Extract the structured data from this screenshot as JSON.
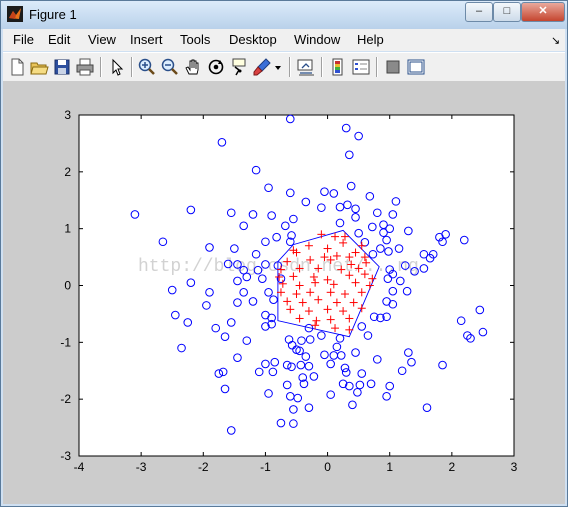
{
  "window": {
    "title": "Figure 1",
    "controls": [
      "minimize",
      "maximize",
      "close"
    ]
  },
  "menu": [
    "File",
    "Edit",
    "View",
    "Insert",
    "Tools",
    "Desktop",
    "Window",
    "Help"
  ],
  "menu_arrow": "↘",
  "toolbar": [
    "new-figure-icon",
    "open-file-icon",
    "save-icon",
    "print-icon",
    "pointer-icon",
    "zoom-in-icon",
    "zoom-out-icon",
    "pan-hand-icon",
    "rotate-3d-icon",
    "data-cursor-icon",
    "brush-icon",
    "brush-dropdown-icon",
    "link-plot-icon",
    "colorbar-icon",
    "legend-icon",
    "hide-plot-tools-icon",
    "show-plot-tools-icon"
  ],
  "watermark": "http://blog.csdn.net/...ng",
  "chart_data": {
    "type": "scatter",
    "title": "",
    "xlabel": "",
    "ylabel": "",
    "xlim": [
      -4,
      3
    ],
    "ylim": [
      -3,
      3
    ],
    "xticks": [
      "-4",
      "-3",
      "-2",
      "-1",
      "0",
      "1",
      "2",
      "3"
    ],
    "yticks": [
      "-3",
      "-2",
      "-1",
      "0",
      "1",
      "2",
      "3"
    ],
    "grid": false,
    "colors": {
      "outer": "#0000ff",
      "inner": "#ff0000",
      "hull": "#0000ff"
    },
    "series": [
      {
        "marker": "o",
        "color": "#0000ff",
        "points": [
          [
            -0.6,
            2.93
          ],
          [
            0.3,
            2.77
          ],
          [
            0.5,
            2.63
          ],
          [
            -1.7,
            2.52
          ],
          [
            0.35,
            2.3
          ],
          [
            -1.15,
            2.03
          ],
          [
            -0.95,
            1.72
          ],
          [
            -0.05,
            1.65
          ],
          [
            0.1,
            1.62
          ],
          [
            0.38,
            1.75
          ],
          [
            -0.6,
            1.63
          ],
          [
            -0.35,
            1.47
          ],
          [
            -0.1,
            1.37
          ],
          [
            0.2,
            1.38
          ],
          [
            0.32,
            1.42
          ],
          [
            0.45,
            1.35
          ],
          [
            0.68,
            1.57
          ],
          [
            1.1,
            1.48
          ],
          [
            -2.2,
            1.33
          ],
          [
            -1.55,
            1.28
          ],
          [
            -1.2,
            1.25
          ],
          [
            -0.9,
            1.23
          ],
          [
            -0.55,
            1.17
          ],
          [
            0.45,
            1.2
          ],
          [
            0.8,
            1.28
          ],
          [
            1.05,
            1.25
          ],
          [
            0.2,
            1.1
          ],
          [
            -1.35,
            1.05
          ],
          [
            -0.68,
            1.05
          ],
          [
            0.72,
            1.03
          ],
          [
            0.9,
            1.07
          ],
          [
            1.0,
            1.0
          ],
          [
            -3.1,
            1.25
          ],
          [
            -0.82,
            0.85
          ],
          [
            -0.58,
            0.88
          ],
          [
            0.5,
            0.92
          ],
          [
            0.9,
            0.93
          ],
          [
            1.3,
            0.96
          ],
          [
            1.8,
            0.85
          ],
          [
            1.9,
            0.9
          ],
          [
            -2.65,
            0.77
          ],
          [
            -1.0,
            0.77
          ],
          [
            -0.6,
            0.77
          ],
          [
            0.6,
            0.76
          ],
          [
            0.95,
            0.8
          ],
          [
            1.85,
            0.77
          ],
          [
            2.2,
            0.8
          ],
          [
            -1.5,
            0.65
          ],
          [
            -1.9,
            0.67
          ],
          [
            0.85,
            0.65
          ],
          [
            1.15,
            0.65
          ],
          [
            -1.15,
            0.55
          ],
          [
            0.73,
            0.55
          ],
          [
            0.98,
            0.6
          ],
          [
            1.55,
            0.55
          ],
          [
            -1.6,
            0.38
          ],
          [
            -1.45,
            0.37
          ],
          [
            -1.0,
            0.37
          ],
          [
            -0.8,
            0.35
          ],
          [
            1.25,
            0.35
          ],
          [
            1.65,
            0.48
          ],
          [
            1.7,
            0.55
          ],
          [
            -1.35,
            0.27
          ],
          [
            -1.12,
            0.27
          ],
          [
            1.0,
            0.28
          ],
          [
            1.4,
            0.25
          ],
          [
            -1.3,
            0.15
          ],
          [
            -1.05,
            0.12
          ],
          [
            -0.75,
            0.12
          ],
          [
            1.05,
            0.2
          ],
          [
            1.55,
            0.3
          ],
          [
            -2.2,
            0.05
          ],
          [
            -1.45,
            0.08
          ],
          [
            0.97,
            0.12
          ],
          [
            1.17,
            0.08
          ],
          [
            -2.5,
            -0.08
          ],
          [
            -1.9,
            -0.12
          ],
          [
            -1.35,
            -0.12
          ],
          [
            -0.95,
            -0.12
          ],
          [
            1.05,
            -0.1
          ],
          [
            1.28,
            -0.1
          ],
          [
            -1.95,
            -0.35
          ],
          [
            -1.45,
            -0.3
          ],
          [
            -1.2,
            -0.28
          ],
          [
            -0.87,
            -0.25
          ],
          [
            0.95,
            -0.28
          ],
          [
            1.05,
            -0.33
          ],
          [
            2.45,
            -0.43
          ],
          [
            -2.25,
            -0.65
          ],
          [
            -1.55,
            -0.65
          ],
          [
            -1.0,
            -0.52
          ],
          [
            -0.9,
            -0.57
          ],
          [
            0.75,
            -0.55
          ],
          [
            0.85,
            -0.57
          ],
          [
            0.95,
            -0.55
          ],
          [
            2.15,
            -0.62
          ],
          [
            -2.45,
            -0.52
          ],
          [
            -1.8,
            -0.75
          ],
          [
            -1.0,
            -0.72
          ],
          [
            -0.9,
            -0.68
          ],
          [
            -0.3,
            -0.75
          ],
          [
            0.55,
            -0.72
          ],
          [
            -1.65,
            -0.9
          ],
          [
            -1.3,
            -0.97
          ],
          [
            -0.62,
            -0.95
          ],
          [
            -0.42,
            -0.97
          ],
          [
            -0.28,
            -0.95
          ],
          [
            -0.1,
            -0.88
          ],
          [
            0.2,
            -0.93
          ],
          [
            0.65,
            -0.88
          ],
          [
            -0.57,
            -1.05
          ],
          [
            -0.45,
            -1.15
          ],
          [
            -0.5,
            -1.13
          ],
          [
            0.15,
            -1.08
          ],
          [
            0.45,
            -1.18
          ],
          [
            1.3,
            -1.18
          ],
          [
            2.5,
            -0.82
          ],
          [
            2.25,
            -0.88
          ],
          [
            2.3,
            -0.93
          ],
          [
            -2.35,
            -1.1
          ],
          [
            -0.35,
            -1.25
          ],
          [
            -0.05,
            -1.22
          ],
          [
            0.1,
            -1.23
          ],
          [
            0.22,
            -1.23
          ],
          [
            0.8,
            -1.3
          ],
          [
            -1.45,
            -1.27
          ],
          [
            -1.0,
            -1.38
          ],
          [
            -0.85,
            -1.35
          ],
          [
            -0.65,
            -1.4
          ],
          [
            -0.58,
            -1.43
          ],
          [
            -0.43,
            -1.4
          ],
          [
            -0.3,
            -1.42
          ],
          [
            0.05,
            -1.38
          ],
          [
            0.28,
            -1.45
          ],
          [
            0.3,
            -1.53
          ],
          [
            0.55,
            -1.55
          ],
          [
            1.35,
            -1.35
          ],
          [
            1.2,
            -1.5
          ],
          [
            1.85,
            -1.4
          ],
          [
            -1.75,
            -1.55
          ],
          [
            -1.68,
            -1.52
          ],
          [
            -1.1,
            -1.52
          ],
          [
            -0.88,
            -1.52
          ],
          [
            -0.4,
            -1.62
          ],
          [
            -0.22,
            -1.6
          ],
          [
            0.25,
            -1.73
          ],
          [
            0.35,
            -1.77
          ],
          [
            -0.65,
            -1.75
          ],
          [
            -0.38,
            -1.73
          ],
          [
            0.52,
            -1.75
          ],
          [
            0.7,
            -1.73
          ],
          [
            1.0,
            -1.77
          ],
          [
            -1.65,
            -1.82
          ],
          [
            -0.95,
            -1.9
          ],
          [
            -0.6,
            -1.95
          ],
          [
            -0.48,
            -1.98
          ],
          [
            0.05,
            -1.92
          ],
          [
            0.48,
            -1.88
          ],
          [
            0.95,
            -1.95
          ],
          [
            -0.55,
            -2.18
          ],
          [
            -0.3,
            -2.15
          ],
          [
            0.4,
            -2.1
          ],
          [
            1.6,
            -2.15
          ],
          [
            -0.75,
            -2.42
          ],
          [
            -0.55,
            -2.43
          ],
          [
            -1.55,
            -2.55
          ]
        ]
      },
      {
        "marker": "+",
        "color": "#ff0000",
        "points": [
          [
            -0.1,
            0.9
          ],
          [
            0.12,
            0.86
          ],
          [
            0.28,
            0.86
          ],
          [
            -0.3,
            0.7
          ],
          [
            0.25,
            0.75
          ],
          [
            0.55,
            0.7
          ],
          [
            -0.55,
            0.62
          ],
          [
            0.0,
            0.65
          ],
          [
            0.45,
            0.58
          ],
          [
            -0.5,
            0.58
          ],
          [
            -0.05,
            0.5
          ],
          [
            0.15,
            0.52
          ],
          [
            0.35,
            0.5
          ],
          [
            0.6,
            0.5
          ],
          [
            -0.65,
            0.42
          ],
          [
            -0.28,
            0.45
          ],
          [
            0.05,
            0.45
          ],
          [
            0.38,
            0.37
          ],
          [
            0.62,
            0.4
          ],
          [
            -0.75,
            0.28
          ],
          [
            -0.45,
            0.3
          ],
          [
            -0.15,
            0.3
          ],
          [
            0.22,
            0.28
          ],
          [
            0.5,
            0.3
          ],
          [
            -0.78,
            0.15
          ],
          [
            -0.55,
            0.16
          ],
          [
            -0.22,
            0.15
          ],
          [
            0.0,
            0.1
          ],
          [
            0.35,
            0.18
          ],
          [
            0.6,
            0.2
          ],
          [
            0.72,
            0.12
          ],
          [
            -0.72,
            0.03
          ],
          [
            -0.45,
            0.0
          ],
          [
            -0.2,
            0.05
          ],
          [
            0.1,
            0.02
          ],
          [
            0.45,
            0.05
          ],
          [
            0.68,
            0.0
          ],
          [
            -0.75,
            -0.12
          ],
          [
            -0.5,
            -0.15
          ],
          [
            -0.28,
            -0.12
          ],
          [
            0.05,
            -0.12
          ],
          [
            0.28,
            -0.15
          ],
          [
            0.55,
            -0.12
          ],
          [
            -0.65,
            -0.28
          ],
          [
            -0.4,
            -0.3
          ],
          [
            -0.15,
            -0.25
          ],
          [
            0.15,
            -0.3
          ],
          [
            0.42,
            -0.3
          ],
          [
            -0.6,
            -0.42
          ],
          [
            -0.3,
            -0.45
          ],
          [
            0.0,
            -0.42
          ],
          [
            0.25,
            -0.45
          ],
          [
            0.55,
            -0.4
          ],
          [
            -0.45,
            -0.58
          ],
          [
            -0.18,
            -0.62
          ],
          [
            0.05,
            -0.6
          ],
          [
            0.35,
            -0.58
          ],
          [
            -0.2,
            -0.7
          ],
          [
            0.12,
            -0.75
          ],
          [
            0.35,
            -0.78
          ]
        ]
      }
    ],
    "hull": [
      [
        -0.8,
        0.42
      ],
      [
        -0.55,
        0.72
      ],
      [
        0.25,
        0.97
      ],
      [
        0.83,
        0.33
      ],
      [
        0.35,
        -0.9
      ],
      [
        -0.8,
        -0.62
      ]
    ]
  }
}
